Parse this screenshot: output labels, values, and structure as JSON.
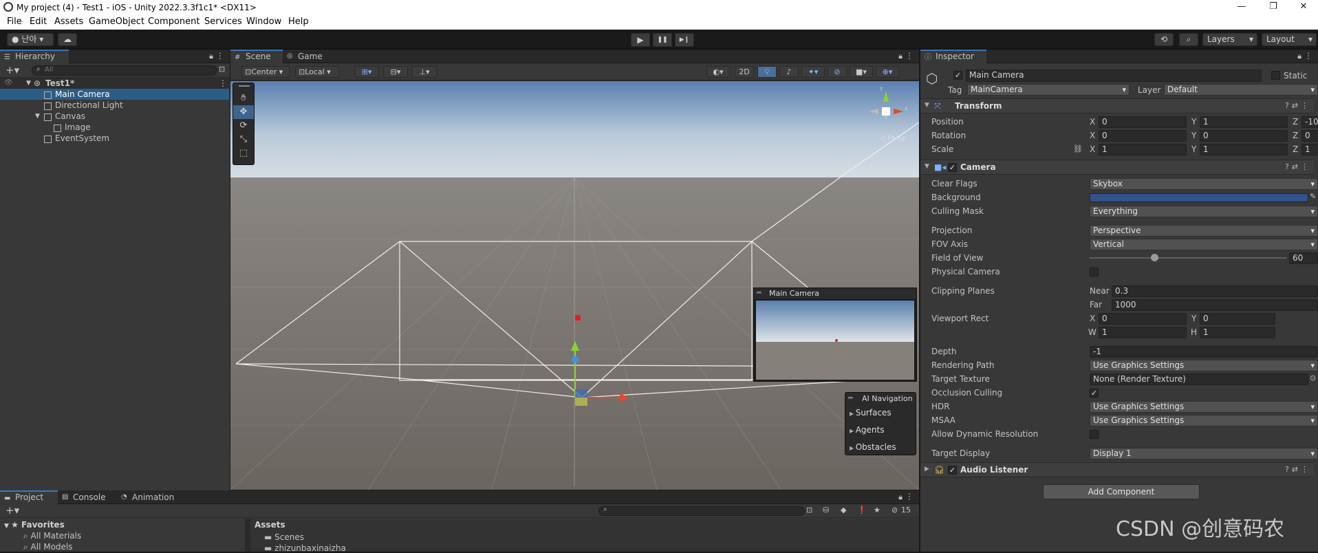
{
  "window": {
    "title": "My project (4) - Test1 - iOS - Unity 2022.3.3f1c1* <DX11>",
    "minimize": "—",
    "maximize": "❐",
    "close": "✕"
  },
  "menu": [
    "File",
    "Edit",
    "Assets",
    "GameObject",
    "Component",
    "Services",
    "Window",
    "Help"
  ],
  "toolbar": {
    "account": "난아",
    "cloud_icon": "cloud-icon",
    "play": "▶",
    "pause": "❚❚",
    "step": "▶❙",
    "layers": "Layers",
    "layout": "Layout"
  },
  "hierarchy": {
    "tab": "Hierarchy",
    "search_placeholder": "All",
    "scene": "Test1*",
    "items": [
      {
        "label": "Main Camera",
        "selected": true
      },
      {
        "label": "Directional Light"
      },
      {
        "label": "Canvas"
      },
      {
        "label": "Image"
      },
      {
        "label": "EventSystem"
      }
    ]
  },
  "scene_view": {
    "tabs": [
      "Scene",
      "Game"
    ],
    "pivot": "Center",
    "space": "Local",
    "mode_2d": "2D",
    "gizmo_persp": "◁ Persp",
    "preview_title": "Main Camera",
    "ai_nav": {
      "title": "AI Navigation",
      "items": [
        "Surfaces",
        "Agents",
        "Obstacles"
      ]
    }
  },
  "inspector": {
    "tab": "Inspector",
    "object_name": "Main Camera",
    "static_label": "Static",
    "tag_label": "Tag",
    "tag_value": "MainCamera",
    "layer_label": "Layer",
    "layer_value": "Default",
    "transform": {
      "title": "Transform",
      "rows": [
        {
          "label": "Position",
          "x": "0",
          "y": "1",
          "z": "-10"
        },
        {
          "label": "Rotation",
          "x": "0",
          "y": "0",
          "z": "0"
        },
        {
          "label": "Scale",
          "x": "1",
          "y": "1",
          "z": "1"
        }
      ]
    },
    "camera": {
      "title": "Camera",
      "clear_flags_label": "Clear Flags",
      "clear_flags": "Skybox",
      "background_label": "Background",
      "background_color": "#31528c",
      "culling_mask_label": "Culling Mask",
      "culling_mask": "Everything",
      "projection_label": "Projection",
      "projection": "Perspective",
      "fov_axis_label": "FOV Axis",
      "fov_axis": "Vertical",
      "fov_label": "Field of View",
      "fov": "60",
      "fov_fraction": 0.33,
      "physical_label": "Physical Camera",
      "clipping_label": "Clipping Planes",
      "near_label": "Near",
      "near": "0.3",
      "far_label": "Far",
      "far": "1000",
      "viewport_label": "Viewport Rect",
      "vp_x": "0",
      "vp_y": "0",
      "vp_w": "1",
      "vp_h": "1",
      "depth_label": "Depth",
      "depth": "-1",
      "rendering_path_label": "Rendering Path",
      "rendering_path": "Use Graphics Settings",
      "target_texture_label": "Target Texture",
      "target_texture": "None (Render Texture)",
      "occlusion_label": "Occlusion Culling",
      "hdr_label": "HDR",
      "hdr": "Use Graphics Settings",
      "msaa_label": "MSAA",
      "msaa": "Use Graphics Settings",
      "dynres_label": "Allow Dynamic Resolution",
      "target_display_label": "Target Display",
      "target_display": "Display 1"
    },
    "audio_listener": "Audio Listener",
    "add_component": "Add Component"
  },
  "project": {
    "tabs": [
      "Project",
      "Console",
      "Animation"
    ],
    "hidden_count": "15",
    "favorites": "Favorites",
    "fav_items": [
      "All Materials",
      "All Models"
    ],
    "assets_header": "Assets",
    "asset_items": [
      "Scenes",
      "zhizunbaxinaizha"
    ]
  },
  "watermark": "CSDN @创意码农"
}
